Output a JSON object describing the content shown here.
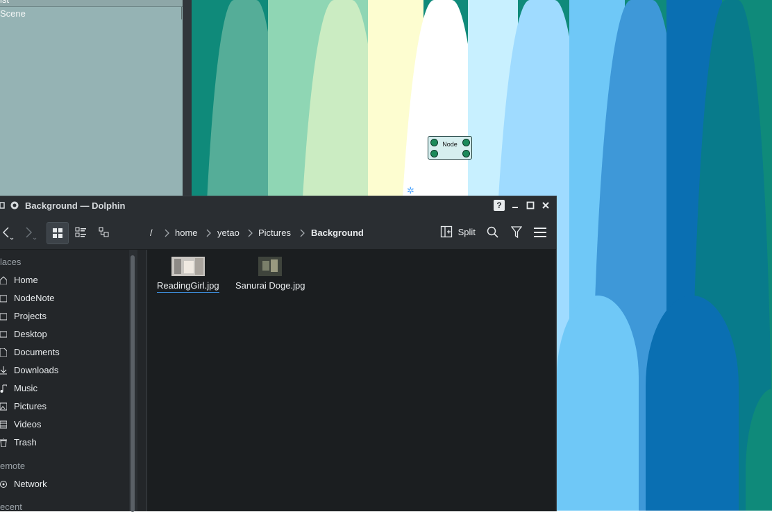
{
  "scene_panel": {
    "header_label": "ist",
    "items": [
      "Scene"
    ]
  },
  "node": {
    "label": "Node"
  },
  "window": {
    "title": "Background — Dolphin"
  },
  "toolbar": {
    "breadcrumb": [
      "/",
      "home",
      "yetao",
      "Pictures",
      "Background"
    ],
    "split_label": "Split"
  },
  "places": {
    "section_places": "laces",
    "items": [
      "Home",
      "NodeNote",
      "Projects",
      "Desktop",
      "Documents",
      "Downloads",
      "Music",
      "Pictures",
      "Videos",
      "Trash"
    ],
    "section_remote": "emote",
    "remote_items": [
      "Network"
    ],
    "section_recent": "ecent"
  },
  "files": [
    {
      "name": "ReadingGirl.jpg",
      "selected": true
    },
    {
      "name": "Sanurai Doge.jpg",
      "selected": false
    }
  ],
  "colors": {
    "accent": "#3d8cd9",
    "window_bg": "#232629"
  }
}
